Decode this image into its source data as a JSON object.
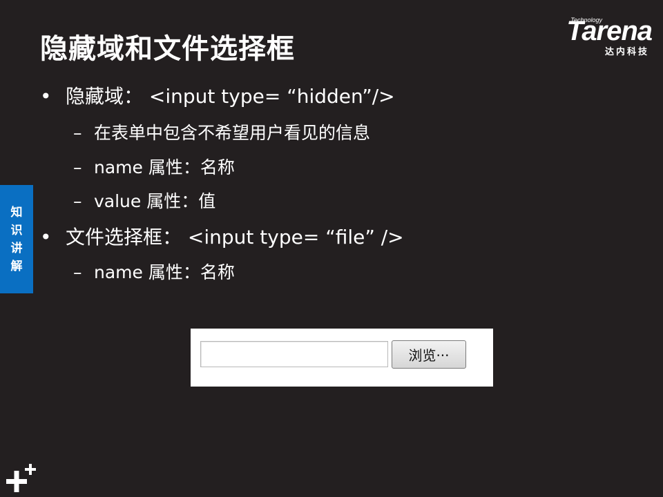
{
  "slide": {
    "title": "隐藏域和文件选择框",
    "side_tab": [
      "知",
      "识",
      "讲",
      "解"
    ]
  },
  "logo": {
    "tech": "Technology",
    "word": "Tarena",
    "cn": "达内科技"
  },
  "content": {
    "bullet1": {
      "marker": "•",
      "text": "隐藏域： <input type= “hidden”/>"
    },
    "sub1_1": {
      "marker": "–",
      "text": "在表单中包含不希望用户看见的信息"
    },
    "sub1_2": {
      "marker": "–",
      "text": "name 属性：名称"
    },
    "sub1_3": {
      "marker": "–",
      "text": "value 属性：值"
    },
    "bullet2": {
      "marker": "•",
      "text": "文件选择框： <input type= “file” />"
    },
    "sub2_1": {
      "marker": "–",
      "text": "name 属性：名称"
    }
  },
  "demo": {
    "file_input_value": "",
    "browse_label": "浏览···"
  },
  "footer": {
    "icon": "plus-plus-icon"
  }
}
